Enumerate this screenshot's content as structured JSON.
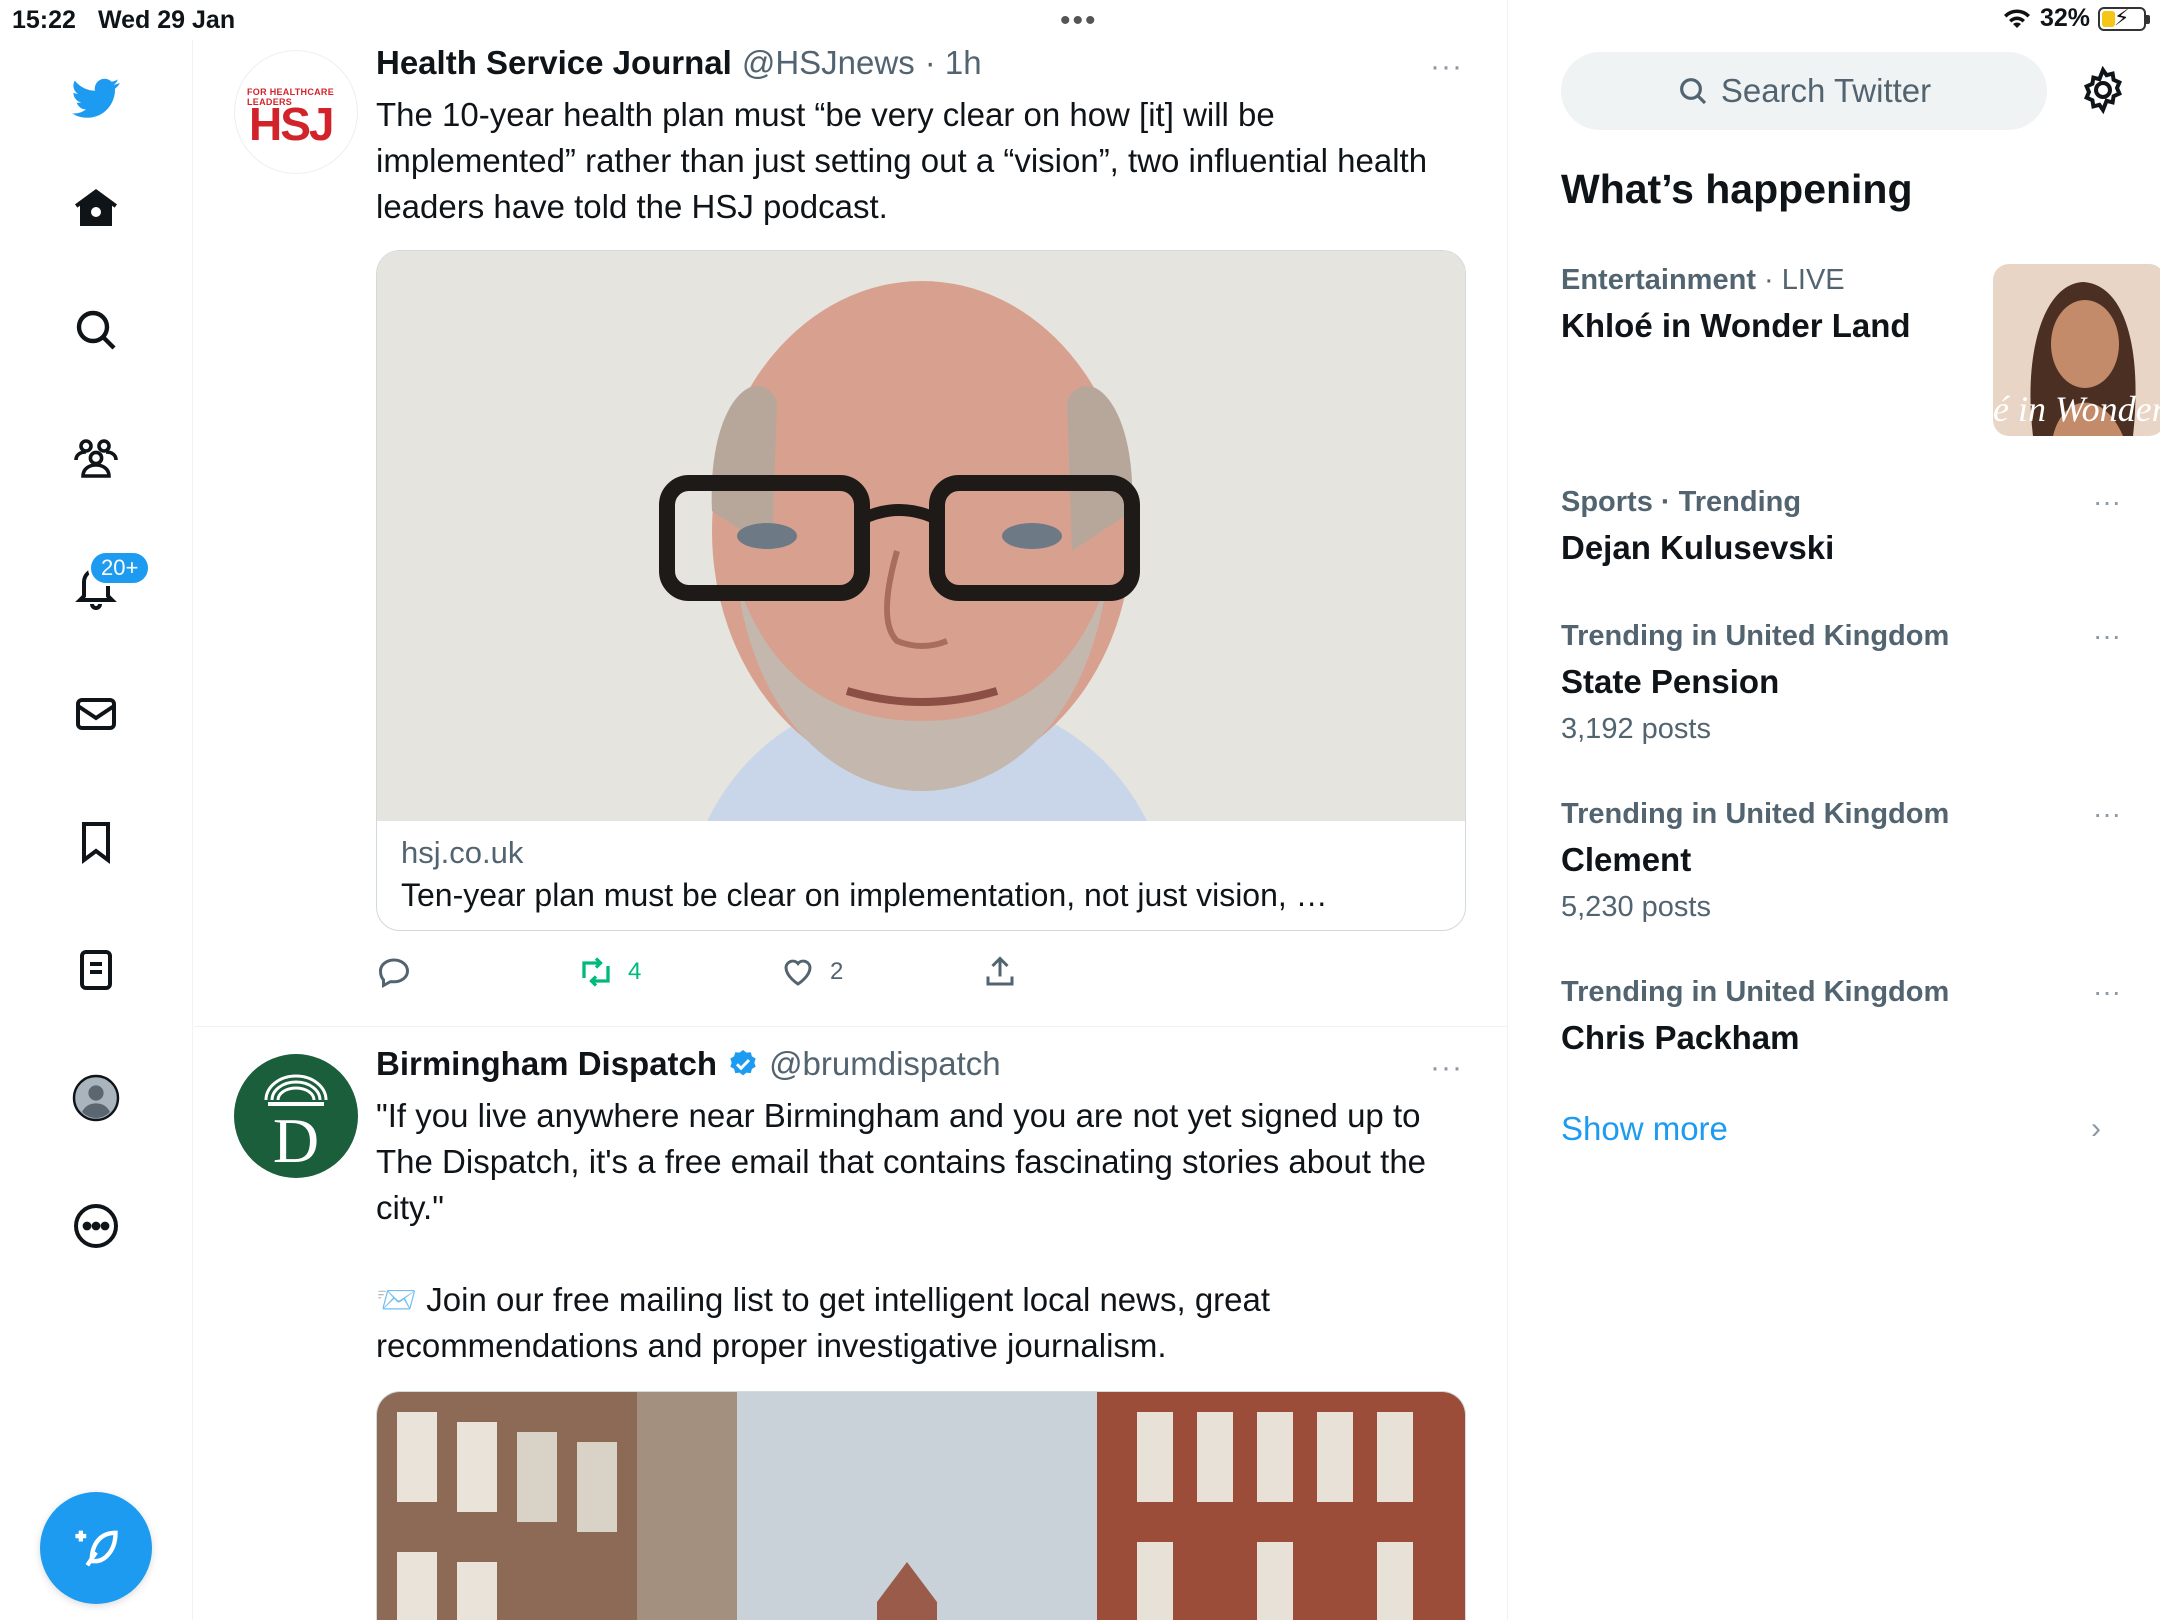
{
  "status_bar": {
    "time": "15:22",
    "date": "Wed 29 Jan",
    "battery": "32%",
    "battery_level": 0.32
  },
  "nav": {
    "items": [
      "twitter-logo",
      "home",
      "explore",
      "communities",
      "notifications",
      "messages",
      "bookmarks",
      "lists",
      "profile",
      "more"
    ],
    "notifications_badge": "20+"
  },
  "feed": {
    "tweets": [
      {
        "name": "Health Service Journal",
        "handle": "@HSJnews",
        "time": "· 1h",
        "avatar_text": "HSJ",
        "avatar_subtext": "FOR HEALTHCARE LEADERS",
        "text": "The 10-year health plan must “be very clear on how [it] will be implemented” rather than just setting out a “vision”, two influential health leaders have told the HSJ podcast.",
        "card": {
          "domain": "hsj.co.uk",
          "title": "Ten-year plan must be clear on implementation, not just vision, …"
        },
        "retweets": "4",
        "likes": "2",
        "more": "···"
      },
      {
        "name": "Birmingham Dispatch",
        "handle": "@brumdispatch",
        "verified": true,
        "avatar_text": "D",
        "text_1": "\"If you live anywhere near Birmingham and you are not yet signed up to The Dispatch, it's a free email that contains fascinating stories about the city.\"",
        "text_2": "📨 Join our free mailing list to get intelligent local news, great recommendations and proper investigative journalism.",
        "more": "···"
      }
    ]
  },
  "sidebar": {
    "search_placeholder": "Search Twitter",
    "section_title": "What’s happening",
    "trends": [
      {
        "context": "Entertainment",
        "context_suffix": "· LIVE",
        "name": "Khloé in Wonder Land",
        "posts": "",
        "thumb_text": "é in Wonder l"
      },
      {
        "context": "Sports · Trending",
        "name": "Dejan Kulusevski",
        "posts": ""
      },
      {
        "context": "Trending in United Kingdom",
        "name": "State Pension",
        "posts": "3,192 posts"
      },
      {
        "context": "Trending in United Kingdom",
        "name": "Clement",
        "posts": "5,230 posts"
      },
      {
        "context": "Trending in United Kingdom",
        "name": "Chris Packham",
        "posts": ""
      }
    ],
    "show_more": "Show more",
    "more": "···"
  },
  "colors": {
    "accent": "#1d9bf0",
    "retweet": "#00ba7c",
    "hsj_red": "#d2232a",
    "dispatch_green": "#1b5e3b"
  }
}
